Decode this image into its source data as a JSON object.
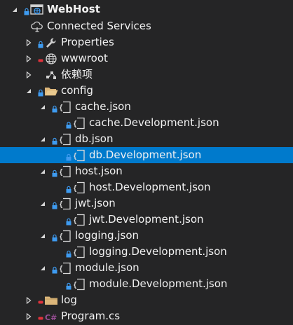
{
  "tree": [
    {
      "label": "WebHost",
      "icon": "web-project-icon",
      "expanded": true,
      "bold": true,
      "lock": "blue"
    },
    {
      "label": "Connected Services",
      "icon": "connected-services-icon",
      "expanded": null,
      "lock": "none"
    },
    {
      "label": "Properties",
      "icon": "wrench-icon",
      "expanded": false,
      "lock": "blue"
    },
    {
      "label": "wwwroot",
      "icon": "globe-icon",
      "expanded": false,
      "lock": "red"
    },
    {
      "label": "依赖项",
      "icon": "dependencies-icon",
      "expanded": false,
      "lock": "none"
    },
    {
      "label": "config",
      "icon": "folder-open-icon",
      "expanded": true,
      "lock": "blue"
    },
    {
      "label": "cache.json",
      "icon": "json-file-icon",
      "expanded": true,
      "lock": "blue"
    },
    {
      "label": "cache.Development.json",
      "icon": "json-file-icon",
      "expanded": null,
      "lock": "blue"
    },
    {
      "label": "db.json",
      "icon": "json-file-icon",
      "expanded": true,
      "lock": "blue"
    },
    {
      "label": "db.Development.json",
      "icon": "json-file-icon",
      "expanded": null,
      "lock": "blue",
      "selected": true
    },
    {
      "label": "host.json",
      "icon": "json-file-icon",
      "expanded": true,
      "lock": "blue"
    },
    {
      "label": "host.Development.json",
      "icon": "json-file-icon",
      "expanded": null,
      "lock": "blue"
    },
    {
      "label": "jwt.json",
      "icon": "json-file-icon",
      "expanded": true,
      "lock": "blue"
    },
    {
      "label": "jwt.Development.json",
      "icon": "json-file-icon",
      "expanded": null,
      "lock": "blue"
    },
    {
      "label": "logging.json",
      "icon": "json-file-icon",
      "expanded": true,
      "lock": "blue"
    },
    {
      "label": "logging.Development.json",
      "icon": "json-file-icon",
      "expanded": null,
      "lock": "blue"
    },
    {
      "label": "module.json",
      "icon": "json-file-icon",
      "expanded": true,
      "lock": "blue"
    },
    {
      "label": "module.Development.json",
      "icon": "json-file-icon",
      "expanded": null,
      "lock": "blue"
    },
    {
      "label": "log",
      "icon": "folder-icon",
      "expanded": false,
      "lock": "red"
    },
    {
      "label": "Program.cs",
      "icon": "csharp-file-icon",
      "expanded": false,
      "lock": "red"
    }
  ],
  "colors": {
    "background": "#252526",
    "selection": "#007acc",
    "text": "#f1f1f1",
    "lock_blue": "#3e9bf0",
    "lock_red": "#e0323c",
    "folder": "#dcb67a",
    "csharp": "#68217a"
  }
}
